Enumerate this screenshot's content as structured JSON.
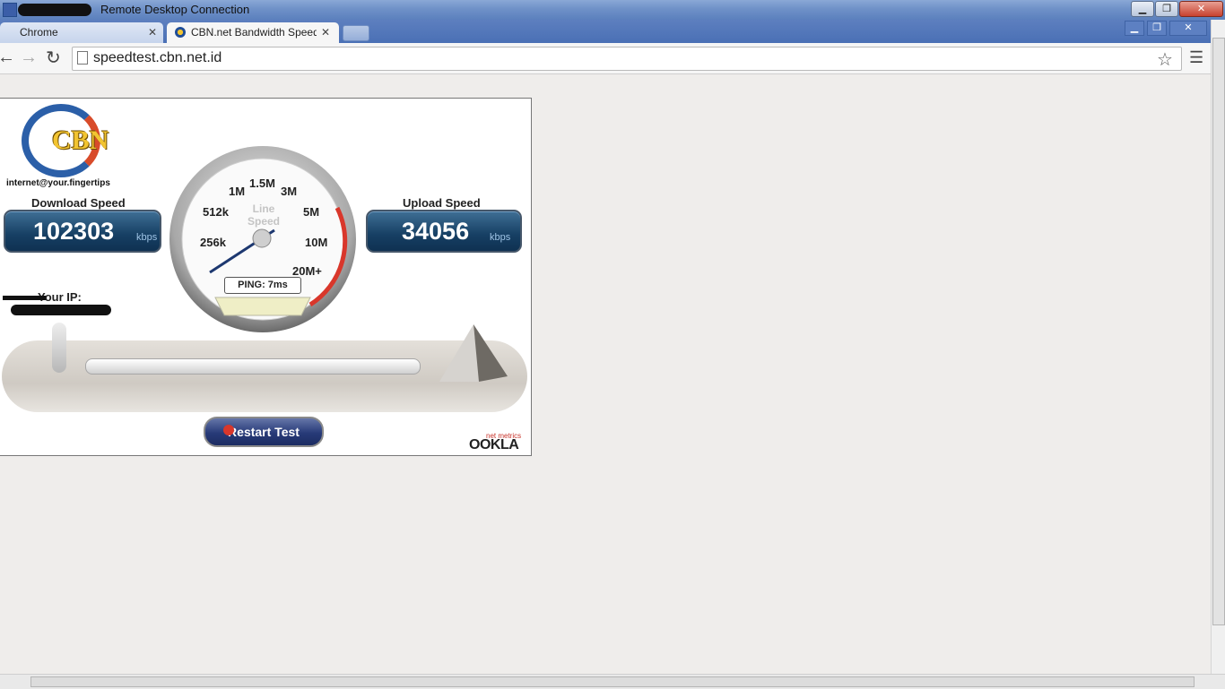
{
  "rdp": {
    "title": "Remote Desktop Connection",
    "minimize": "▁",
    "restore": "❐",
    "close": "✕"
  },
  "browser": {
    "tabs": [
      {
        "label": "Chrome",
        "active": false
      },
      {
        "label": "CBN.net Bandwidth Speed Te",
        "active": true
      }
    ],
    "url": "speedtest.cbn.net.id"
  },
  "speedtest": {
    "logo_text": "CBN",
    "tagline": "internet@your.fingertips",
    "download_label": "Download Speed",
    "download_value": "102303",
    "download_unit": "kbps",
    "upload_label": "Upload Speed",
    "upload_value": "34056",
    "upload_unit": "kbps",
    "ip_label": "Your IP:",
    "gauge_title": "Line Speed",
    "gauge_ticks": [
      "256k",
      "512k",
      "1M",
      "1.5M",
      "3M",
      "5M",
      "10M",
      "20M+"
    ],
    "ping": "PING: 7ms",
    "restart_label": "Restart Test",
    "brand_small": "net metrics",
    "brand": "OOKLA"
  },
  "colors": {
    "accent_red": "#d9372b",
    "speedbox": "#163f63"
  }
}
